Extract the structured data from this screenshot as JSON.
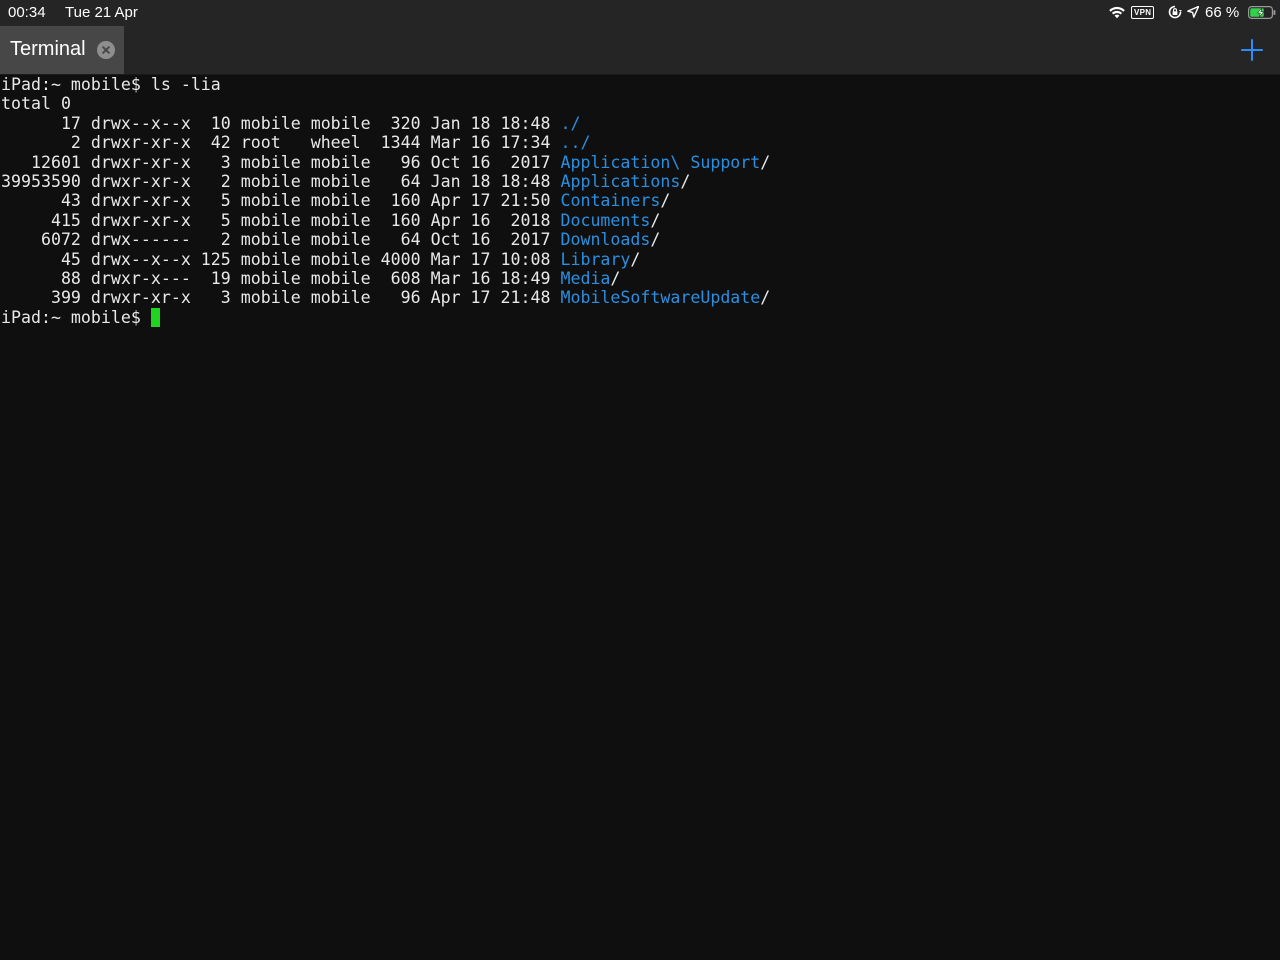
{
  "status_bar": {
    "time": "00:34",
    "date": "Tue 21 Apr",
    "vpn_label": "VPN",
    "battery_percent": "66 %",
    "battery_level": 0.66,
    "icons": [
      "wifi-icon",
      "orientation-lock-icon",
      "location-icon",
      "battery-charging-icon"
    ]
  },
  "tab_bar": {
    "tabs": [
      {
        "label": "Terminal",
        "active": true
      }
    ],
    "accent_color": "#2f8cff"
  },
  "terminal": {
    "prompt": "iPad:~ mobile$ ",
    "command": "ls -lia",
    "total_line": "total 0",
    "dir_color": "#2a8fe0",
    "cursor_color": "#1fd51f",
    "entries": [
      {
        "cols": "      17 drwx--x--x  10 mobile mobile  320 Jan 18 18:48 ",
        "name": "./",
        "suffix": ""
      },
      {
        "cols": "       2 drwxr-xr-x  42 root   wheel  1344 Mar 16 17:34 ",
        "name": "../",
        "suffix": ""
      },
      {
        "cols": "   12601 drwxr-xr-x   3 mobile mobile   96 Oct 16  2017 ",
        "name": "Application\\ Support",
        "suffix": "/"
      },
      {
        "cols": "39953590 drwxr-xr-x   2 mobile mobile   64 Jan 18 18:48 ",
        "name": "Applications",
        "suffix": "/"
      },
      {
        "cols": "      43 drwxr-xr-x   5 mobile mobile  160 Apr 17 21:50 ",
        "name": "Containers",
        "suffix": "/"
      },
      {
        "cols": "     415 drwxr-xr-x   5 mobile mobile  160 Apr 16  2018 ",
        "name": "Documents",
        "suffix": "/"
      },
      {
        "cols": "    6072 drwx------   2 mobile mobile   64 Oct 16  2017 ",
        "name": "Downloads",
        "suffix": "/"
      },
      {
        "cols": "      45 drwx--x--x 125 mobile mobile 4000 Mar 17 10:08 ",
        "name": "Library",
        "suffix": "/"
      },
      {
        "cols": "      88 drwxr-x---  19 mobile mobile  608 Mar 16 18:49 ",
        "name": "Media",
        "suffix": "/"
      },
      {
        "cols": "     399 drwxr-xr-x   3 mobile mobile   96 Apr 17 21:48 ",
        "name": "MobileSoftwareUpdate",
        "suffix": "/"
      }
    ]
  }
}
